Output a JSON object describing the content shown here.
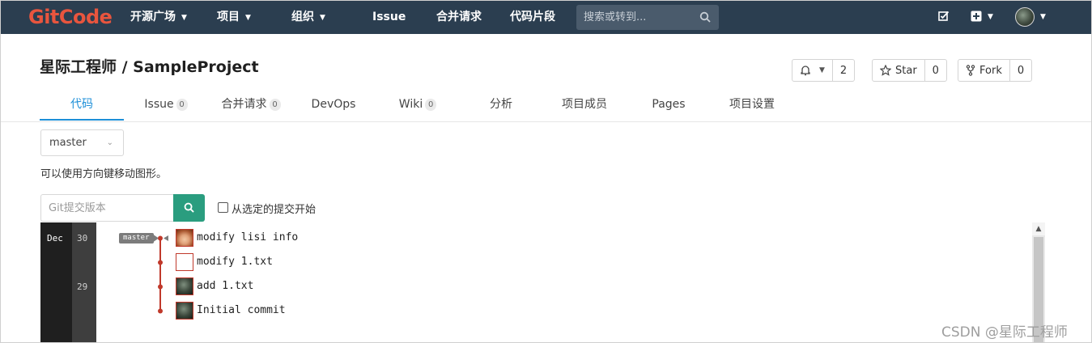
{
  "nav": {
    "logo": "GitCode",
    "items": [
      {
        "label": "开源广场",
        "caret": true
      },
      {
        "label": "项目",
        "caret": true
      },
      {
        "label": "组织",
        "caret": true
      },
      {
        "label": "Issue",
        "caret": false
      },
      {
        "label": "合并请求",
        "caret": false
      },
      {
        "label": "代码片段",
        "caret": false
      }
    ],
    "search_placeholder": "搜索或转到..."
  },
  "project": {
    "title": "星际工程师 / SampleProject",
    "watch_count": "2",
    "star_label": "Star",
    "star_count": "0",
    "fork_label": "Fork",
    "fork_count": "0"
  },
  "tabs": [
    {
      "label": "代码",
      "active": true,
      "count": null
    },
    {
      "label": "Issue",
      "active": false,
      "count": "0"
    },
    {
      "label": "合并请求",
      "active": false,
      "count": "0"
    },
    {
      "label": "DevOps",
      "active": false,
      "count": null
    },
    {
      "label": "Wiki",
      "active": false,
      "count": "0"
    },
    {
      "label": "分析",
      "active": false,
      "count": null
    },
    {
      "label": "项目成员",
      "active": false,
      "count": null
    },
    {
      "label": "Pages",
      "active": false,
      "count": null
    },
    {
      "label": "项目设置",
      "active": false,
      "count": null
    }
  ],
  "branch_select": "master",
  "hint": "可以使用方向键移动图形。",
  "commit_search": {
    "placeholder": "Git提交版本",
    "checkbox_label": "从选定的提交开始",
    "checked": false
  },
  "graph": {
    "month": "Dec",
    "branch_tag": "master",
    "days": [
      "30",
      "29"
    ],
    "commits": [
      {
        "message": "modify lisi info",
        "avatar": "face"
      },
      {
        "message": "modify 1.txt",
        "avatar": "blank"
      },
      {
        "message": "add 1.txt",
        "avatar": "dark"
      },
      {
        "message": "Initial commit",
        "avatar": "dark"
      }
    ]
  },
  "colors": {
    "nav_bg": "#2b3e50",
    "logo": "#e8553e",
    "active_tab": "#1d8fd8",
    "search_button": "#2a9d7f",
    "graph_line": "#c0392b"
  },
  "watermark": "CSDN @星际工程师"
}
